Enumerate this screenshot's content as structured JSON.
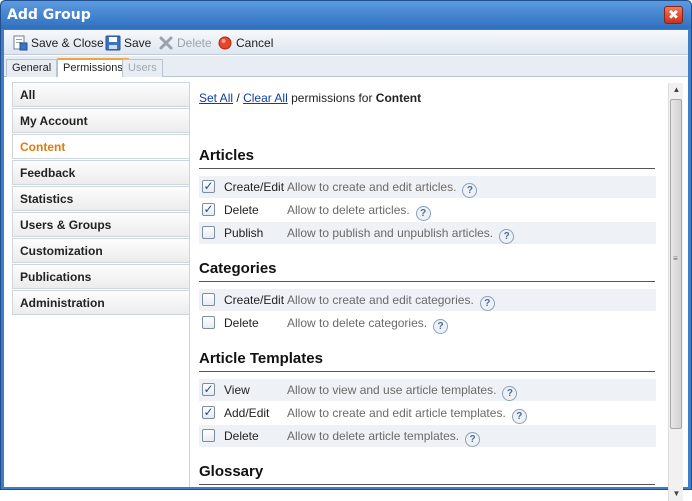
{
  "window": {
    "title": "Add Group",
    "close_glyph": "✖"
  },
  "toolbar": {
    "save_close": "Save & Close",
    "save": "Save",
    "delete": "Delete",
    "cancel": "Cancel"
  },
  "tabs": [
    {
      "label": "General"
    },
    {
      "label": "Permissions"
    },
    {
      "label": "Users"
    }
  ],
  "sidebar": {
    "items": [
      {
        "label": "All"
      },
      {
        "label": "My Account"
      },
      {
        "label": "Content"
      },
      {
        "label": "Feedback"
      },
      {
        "label": "Statistics"
      },
      {
        "label": "Users & Groups"
      },
      {
        "label": "Customization"
      },
      {
        "label": "Publications"
      },
      {
        "label": "Administration"
      }
    ],
    "active": "Content"
  },
  "header": {
    "set_all": "Set All",
    "separator": "/",
    "clear_all": "Clear All",
    "permissions_for": "permissions for",
    "section": "Content"
  },
  "sections": [
    {
      "title": "Articles",
      "rows": [
        {
          "name": "Create/Edit",
          "desc": "Allow to create and edit articles.",
          "checked": true
        },
        {
          "name": "Delete",
          "desc": "Allow to delete articles.",
          "checked": true
        },
        {
          "name": "Publish",
          "desc": "Allow to publish and unpublish articles.",
          "checked": false
        }
      ]
    },
    {
      "title": "Categories",
      "rows": [
        {
          "name": "Create/Edit",
          "desc": "Allow to create and edit categories.",
          "checked": false
        },
        {
          "name": "Delete",
          "desc": "Allow to delete categories.",
          "checked": false
        }
      ]
    },
    {
      "title": "Article Templates",
      "rows": [
        {
          "name": "View",
          "desc": "Allow to view and use article templates.",
          "checked": true
        },
        {
          "name": "Add/Edit",
          "desc": "Allow to create and edit article templates.",
          "checked": true
        },
        {
          "name": "Delete",
          "desc": "Allow to delete article templates.",
          "checked": false
        }
      ]
    },
    {
      "title": "Glossary",
      "rows": []
    }
  ],
  "icons": {
    "help": "?",
    "check": "✓",
    "scroll_up": "▲",
    "scroll_down": "▼",
    "grip": "≡"
  },
  "colors": {
    "title_bar": "#3f7dc7",
    "active_sidebar_text": "#e07b10",
    "link": "#0d3ea8",
    "close_button": "#c9321b"
  }
}
